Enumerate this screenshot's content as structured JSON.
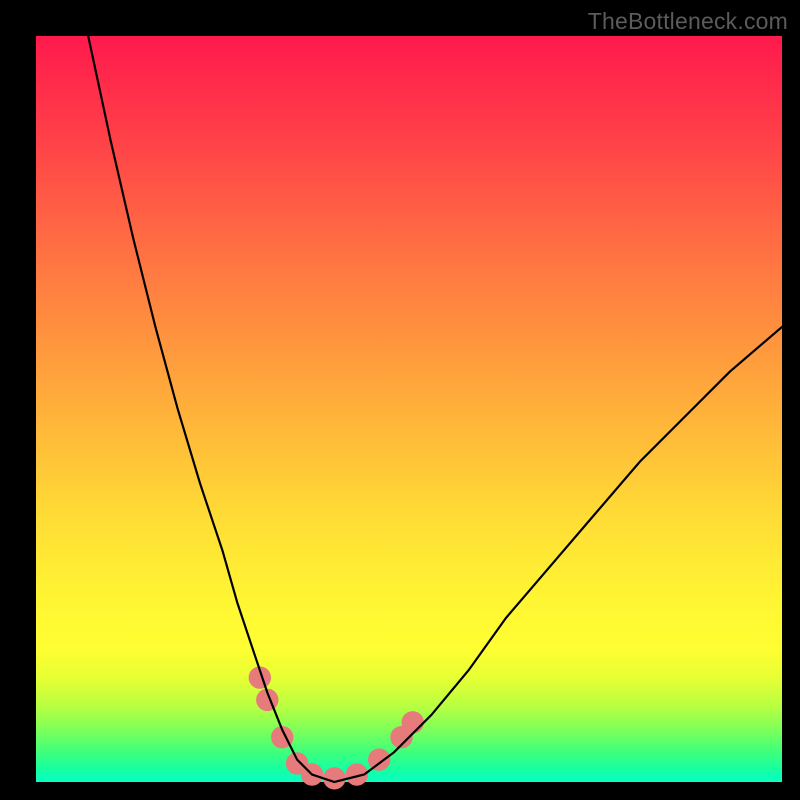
{
  "watermark": "TheBottleneck.com",
  "chart_data": {
    "type": "line",
    "title": "",
    "xlabel": "",
    "ylabel": "",
    "xlim": [
      0,
      100
    ],
    "ylim": [
      0,
      100
    ],
    "grid": false,
    "gradient_stops": [
      {
        "pct": 0,
        "color": "#ff1a4d"
      },
      {
        "pct": 14,
        "color": "#ff4148"
      },
      {
        "pct": 31,
        "color": "#ff7742"
      },
      {
        "pct": 48,
        "color": "#ffaa3b"
      },
      {
        "pct": 63,
        "color": "#ffd836"
      },
      {
        "pct": 82,
        "color": "#fffe32"
      },
      {
        "pct": 93,
        "color": "#7dff5a"
      },
      {
        "pct": 100,
        "color": "#06ffc4"
      }
    ],
    "series": [
      {
        "name": "curve",
        "x": [
          7,
          10,
          13,
          16,
          19,
          22,
          25,
          27,
          29,
          31,
          33,
          35,
          37,
          40,
          44,
          48,
          53,
          58,
          63,
          69,
          75,
          81,
          87,
          93,
          100
        ],
        "y": [
          100,
          86,
          73,
          61,
          50,
          40,
          31,
          24,
          18,
          12,
          7,
          3,
          1,
          0,
          1,
          4,
          9,
          15,
          22,
          29,
          36,
          43,
          49,
          55,
          61
        ]
      }
    ],
    "markers": {
      "name": "valley-markers",
      "color": "#e77a7a",
      "radius_pct": 1.5,
      "points": [
        {
          "x": 30,
          "y": 14
        },
        {
          "x": 31,
          "y": 11
        },
        {
          "x": 33,
          "y": 6
        },
        {
          "x": 35,
          "y": 2.5
        },
        {
          "x": 37,
          "y": 1
        },
        {
          "x": 40,
          "y": 0.5
        },
        {
          "x": 43,
          "y": 1
        },
        {
          "x": 46,
          "y": 3
        },
        {
          "x": 49,
          "y": 6
        },
        {
          "x": 50.5,
          "y": 8
        }
      ]
    }
  }
}
